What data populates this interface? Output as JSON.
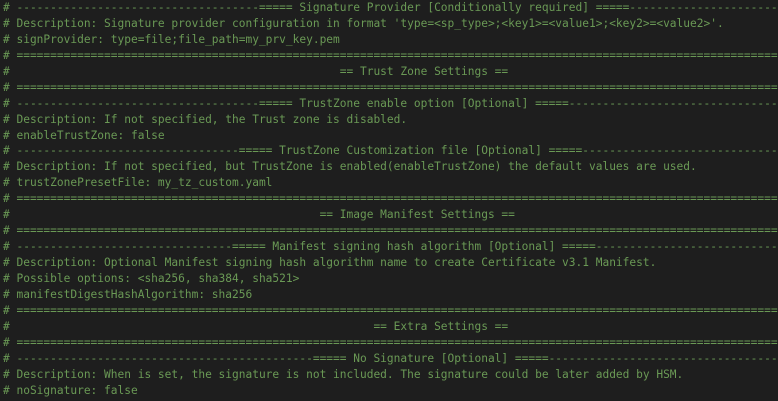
{
  "editor": {
    "theme_colors": {
      "background": "#1e1e1e",
      "comment": "#6a9955"
    },
    "lines": [
      "# ------------------------------------===== Signature Provider [Conditionally required] =====--------------------------------------",
      "# Description: Signature provider configuration in format 'type=<sp_type>;<key1>=<value1>;<key2>=<value2>'.",
      "# signProvider: type=file;file_path=my_prv_key.pem",
      "# ==================================================================================================================================",
      "#                                                 == Trust Zone Settings ==",
      "# ==================================================================================================================================",
      "# ------------------------------------===== TrustZone enable option [Optional] =====-----------------------------------------------",
      "# Description: If not specified, the Trust zone is disabled.",
      "# enableTrustZone: false",
      "# ---------------------------------===== TrustZone Customization file [Optional] =====---------------------------------------------",
      "# Description: If not specified, but TrustZone is enabled(enableTrustZone) the default values are used.",
      "# trustZonePresetFile: my_tz_custom.yaml",
      "# ==================================================================================================================================",
      "#                                              == Image Manifest Settings ==",
      "# ==================================================================================================================================",
      "# --------------------------------===== Manifest signing hash algorithm [Optional] =====-------------------------------------------",
      "# Description: Optional Manifest signing hash algorithm name to create Certificate v3.1 Manifest.",
      "# Possible options: <sha256, sha384, sha521>",
      "# manifestDigestHashAlgorithm: sha256",
      "# ==================================================================================================================================",
      "#                                                      == Extra Settings ==",
      "# ==================================================================================================================================",
      "# --------------------------------------------===== No Signature [Optional] =====--------------------------------------------------",
      "# Description: When is set, the signature is not included. The signature could be later added by HSM.",
      "# noSignature: false"
    ]
  }
}
